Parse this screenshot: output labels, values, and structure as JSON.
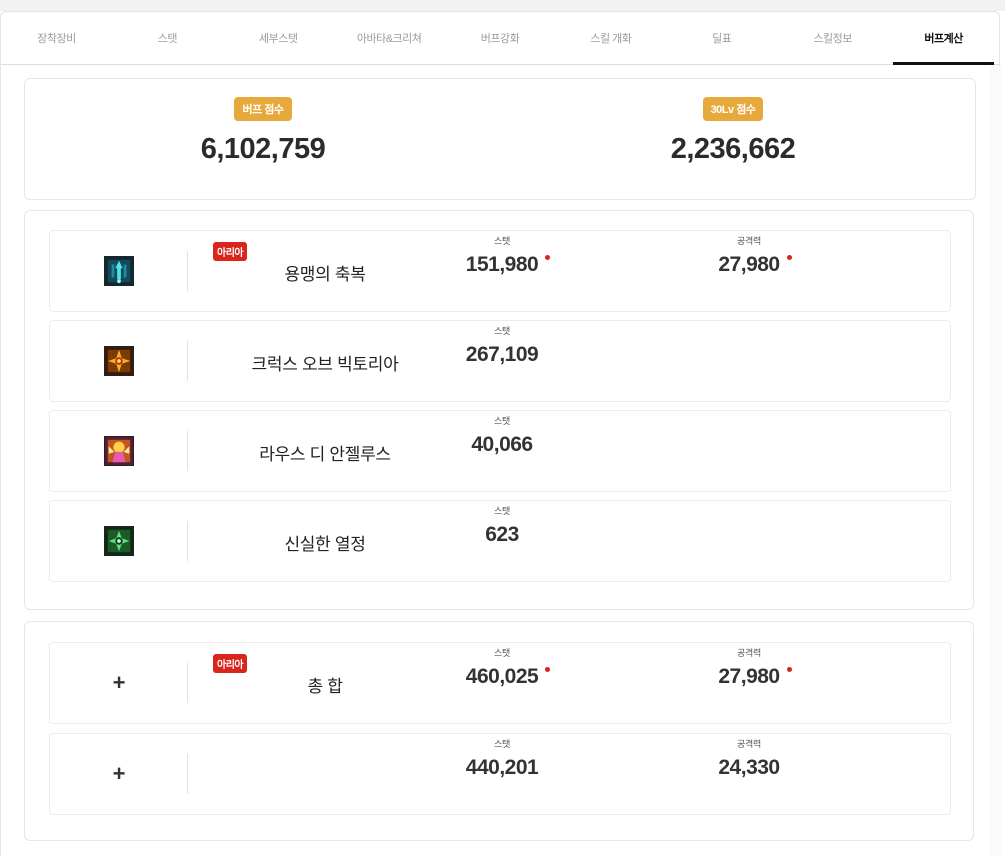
{
  "tabs": [
    {
      "label": "장착장비",
      "active": false
    },
    {
      "label": "스탯",
      "active": false
    },
    {
      "label": "세부스탯",
      "active": false
    },
    {
      "label": "아바타&크리쳐",
      "active": false
    },
    {
      "label": "버프강화",
      "active": false
    },
    {
      "label": "스킬 개화",
      "active": false
    },
    {
      "label": "딜표",
      "active": false
    },
    {
      "label": "스킬정보",
      "active": false
    },
    {
      "label": "버프계산",
      "active": true
    }
  ],
  "scores": {
    "buff": {
      "label": "버프 점수",
      "value": "6,102,759"
    },
    "lv30": {
      "label": "30Lv 점수",
      "value": "2,236,662"
    }
  },
  "colors": {
    "accent": "#e8a93c",
    "badge_red": "#d9251c"
  },
  "labels": {
    "stat": "스탯",
    "attack": "공격력",
    "badge": "아리아"
  },
  "skills": [
    {
      "name": "용맹의 축복",
      "icon": "blessing-of-valor-icon",
      "badge": true,
      "stat": "151,980",
      "stat_dot": true,
      "attack": "27,980",
      "attack_dot": true
    },
    {
      "name": "크럭스 오브 빅토리아",
      "icon": "crux-of-victoria-icon",
      "badge": false,
      "stat": "267,109",
      "stat_dot": false,
      "attack": null,
      "attack_dot": false
    },
    {
      "name": "라우스 디 안젤루스",
      "icon": "laus-di-angelus-icon",
      "badge": false,
      "stat": "40,066",
      "stat_dot": false,
      "attack": null,
      "attack_dot": false
    },
    {
      "name": "신실한 열정",
      "icon": "faithful-passion-icon",
      "badge": false,
      "stat": "623",
      "stat_dot": false,
      "attack": null,
      "attack_dot": false
    }
  ],
  "totals": [
    {
      "icon_char": "+",
      "name": "총 합",
      "badge": true,
      "stat": "460,025",
      "stat_dot": true,
      "attack": "27,980",
      "attack_dot": true
    },
    {
      "icon_char": "+",
      "name": "",
      "badge": false,
      "stat": "440,201",
      "stat_dot": false,
      "attack": "24,330",
      "attack_dot": false
    }
  ]
}
